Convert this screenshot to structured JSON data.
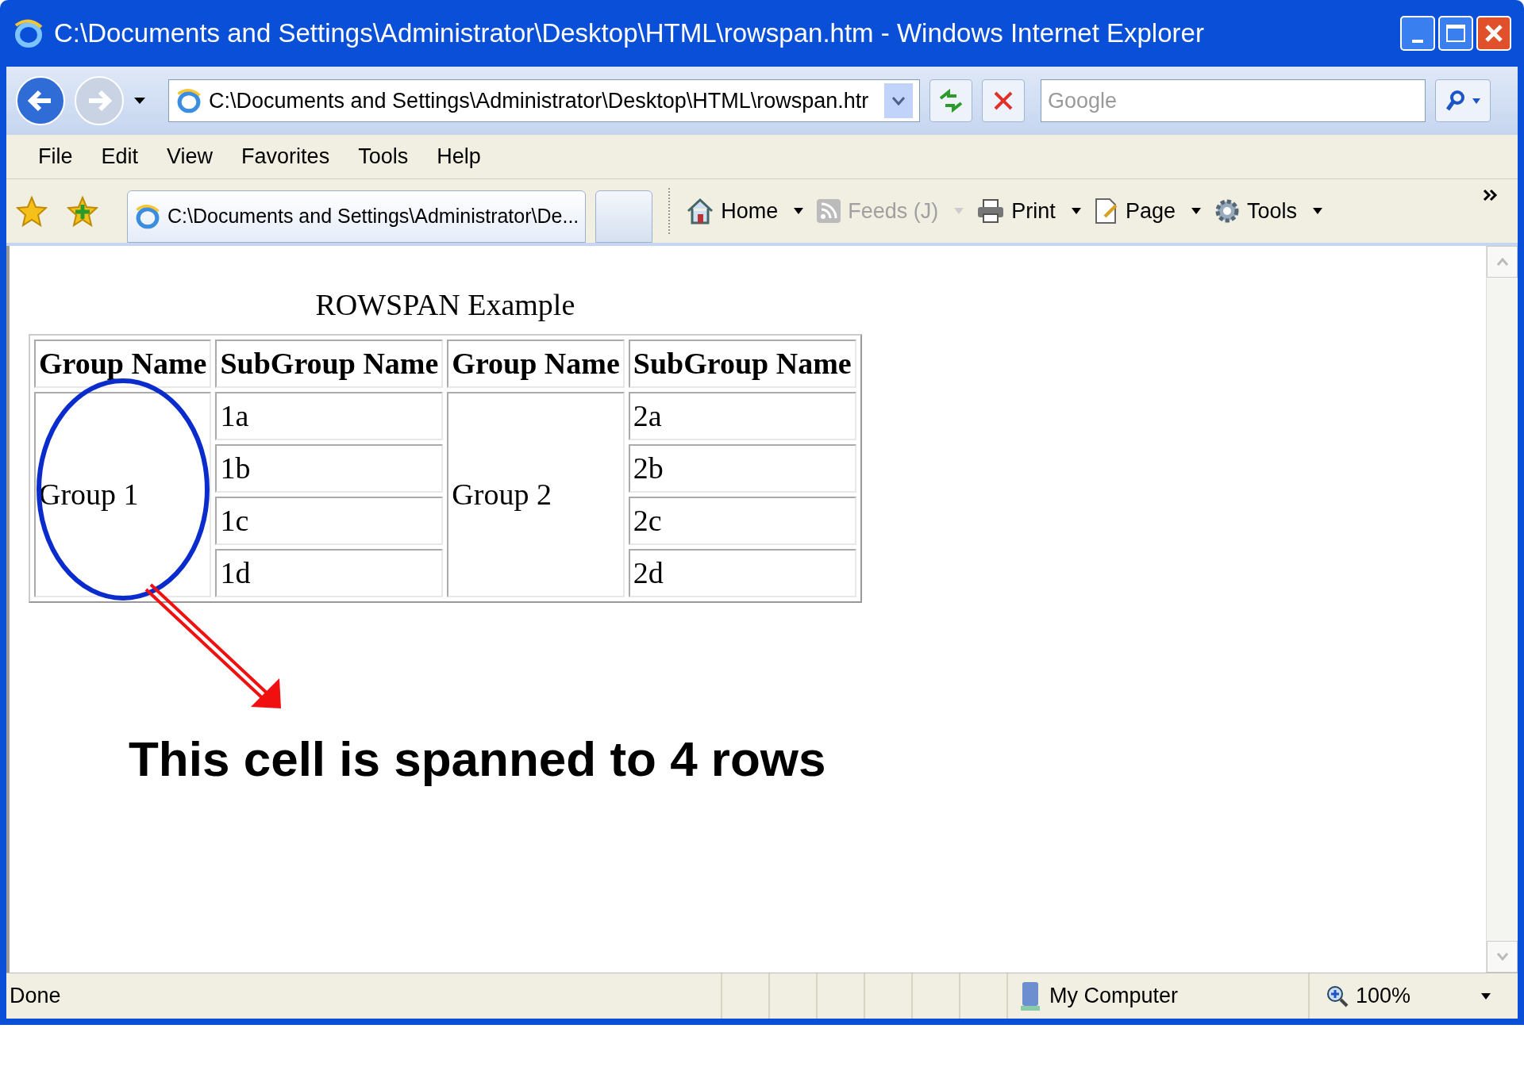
{
  "window": {
    "title": "C:\\Documents and Settings\\Administrator\\Desktop\\HTML\\rowspan.htm - Windows Internet Explorer"
  },
  "address_bar": {
    "value": "C:\\Documents and Settings\\Administrator\\Desktop\\HTML\\rowspan.htr"
  },
  "search": {
    "placeholder": "Google"
  },
  "menu": [
    "File",
    "Edit",
    "View",
    "Favorites",
    "Tools",
    "Help"
  ],
  "tabs": [
    {
      "label": "C:\\Documents and Settings\\Administrator\\De...",
      "selected": true
    }
  ],
  "command_bar": [
    {
      "kind": "home",
      "label": "Home",
      "disabled": false
    },
    {
      "kind": "feeds",
      "label": "Feeds (J)",
      "disabled": true
    },
    {
      "kind": "print",
      "label": "Print",
      "disabled": false
    },
    {
      "kind": "page",
      "label": "Page",
      "disabled": false
    },
    {
      "kind": "tools",
      "label": "Tools",
      "disabled": false
    }
  ],
  "page": {
    "caption": "ROWSPAN Example",
    "table": {
      "columns": [
        "Group Name",
        "SubGroup Name",
        "Group Name",
        "SubGroup Name"
      ],
      "groups": [
        {
          "names": [
            "Group 1",
            "Group 2"
          ],
          "items": [
            [
              "1a",
              "2a"
            ],
            [
              "1b",
              "2b"
            ],
            [
              "1c",
              "2c"
            ],
            [
              "1d",
              "2d"
            ]
          ]
        }
      ]
    }
  },
  "annotation": {
    "text": "This cell is spanned to 4 rows"
  },
  "status_bar": {
    "status": "Done",
    "zone": "My Computer",
    "zoom": "100%"
  }
}
